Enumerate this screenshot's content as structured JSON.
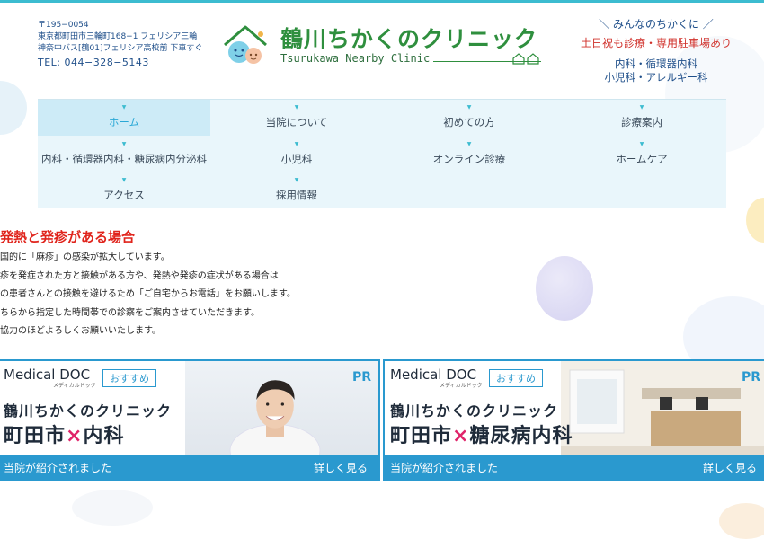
{
  "header": {
    "address": {
      "zip": "〒195−0054",
      "line1": "東京都町田市三輪町168−1 フェリシア三輪",
      "line2": "神奈中バス[鶴01]フェリシア高校前 下車すぐ",
      "tel": "TEL: 044−328−5143"
    },
    "logo": {
      "name": "鶴川ちかくのクリニック",
      "en": "Tsurukawa Nearby Clinic"
    },
    "tagline": {
      "line1": "＼ みんなのちかくに ／",
      "line2": "土日祝も診療・専用駐車場あり",
      "line3": "内科・循環器内科",
      "line4": "小児科・アレルギー科"
    }
  },
  "nav": {
    "items": [
      {
        "label": "ホーム",
        "active": true
      },
      {
        "label": "当院について"
      },
      {
        "label": "初めての方"
      },
      {
        "label": "診療案内"
      },
      {
        "label": "内科・循環器内科・糖尿病内分泌科"
      },
      {
        "label": "小児科"
      },
      {
        "label": "オンライン診療"
      },
      {
        "label": "ホームケア"
      },
      {
        "label": "アクセス"
      },
      {
        "label": "採用情報"
      }
    ]
  },
  "notice": {
    "title": "発熱と発疹がある場合",
    "lines": [
      "国的に「麻疹」の感染が拡大しています。",
      "疹を発症された方と接触がある方や、発熱や発疹の症状がある場合は",
      "の患者さんとの接触を避けるため「ご自宅からお電話」をお願いします。",
      "ちらから指定した時間帯での診察をご案内させていただきます。",
      "協力のほどよろしくお願いいたします。"
    ]
  },
  "banners": [
    {
      "brand": "Medical DOC",
      "brand_sub": "メディカルドック",
      "badge": "おすすめ",
      "pr": "PR",
      "clinic": "鶴川ちかくのクリニック",
      "spec_a": "町田市",
      "spec_x": "×",
      "spec_b": "内科",
      "bar_left": "当院が紹介されました",
      "bar_right": "詳しく見る"
    },
    {
      "brand": "Medical DOC",
      "brand_sub": "メディカルドック",
      "badge": "おすすめ",
      "pr": "PR",
      "clinic": "鶴川ちかくのクリニック",
      "spec_a": "町田市",
      "spec_x": "×",
      "spec_b": "糖尿病内科",
      "bar_left": "当院が紹介されました",
      "bar_right": "詳しく見る"
    }
  ],
  "colors": {
    "accent": "#2a99cf",
    "brand_green": "#2f8f3e",
    "alert_red": "#e0241c",
    "nav_bg": "#e9f6fb"
  }
}
